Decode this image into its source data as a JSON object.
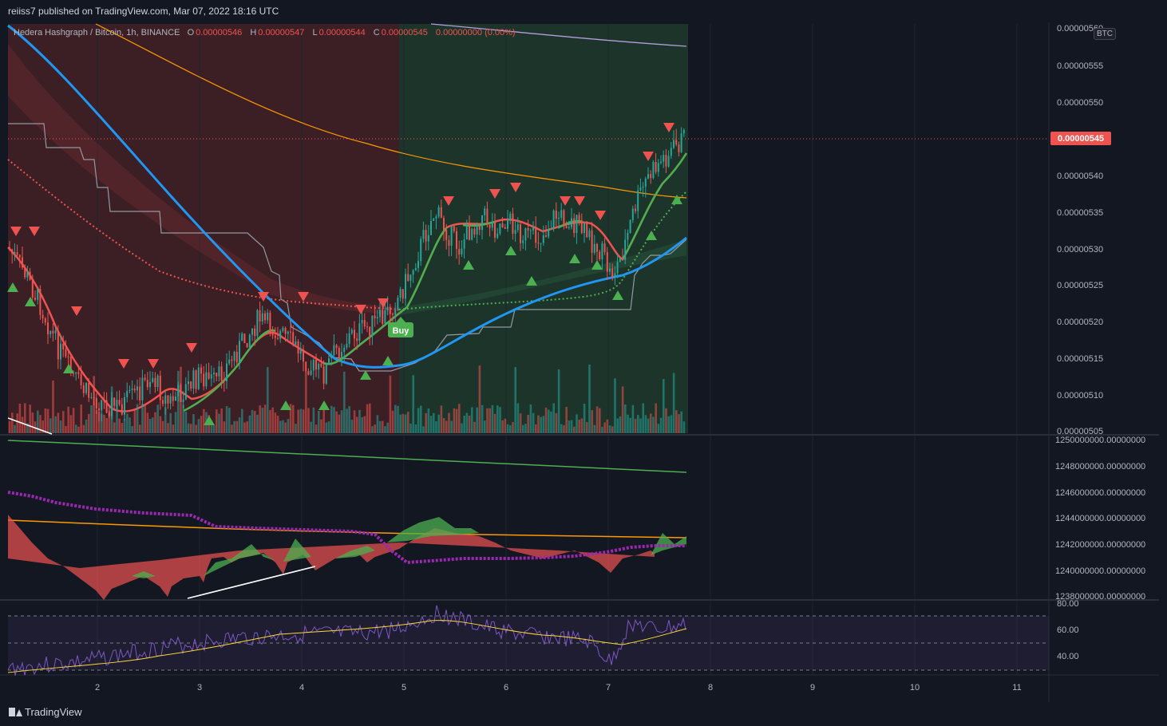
{
  "header": {
    "published": "reiiss7 published on TradingView.com, Mar 07, 2022 18:16 UTC"
  },
  "legend": {
    "symbol": "Hedera Hashgraph / Bitcoin, 1h, BINANCE",
    "o_label": "O",
    "o": "0.00000546",
    "h_label": "H",
    "h": "0.00000547",
    "l_label": "L",
    "l": "0.00000544",
    "c_label": "C",
    "c": "0.00000545",
    "change": "0.00000000 (0.00%)",
    "currency": "BTC"
  },
  "price_axis": {
    "ticks": [
      "0.00000560",
      "0.00000555",
      "0.00000550",
      "0.00000540",
      "0.00000535",
      "0.00000530",
      "0.00000525",
      "0.00000520",
      "0.00000515",
      "0.00000510",
      "0.00000505"
    ],
    "current": "0.00000545"
  },
  "osc_axis": {
    "ticks": [
      "1250000000.00000000",
      "1248000000.00000000",
      "1246000000.00000000",
      "1244000000.00000000",
      "1242000000.00000000",
      "1240000000.00000000",
      "1238000000.00000000"
    ]
  },
  "rsi_axis": {
    "ticks": [
      "80.00",
      "60.00",
      "40.00"
    ]
  },
  "time_axis": {
    "ticks": [
      "2",
      "3",
      "4",
      "5",
      "6",
      "7",
      "8",
      "9",
      "10",
      "11"
    ]
  },
  "signals": {
    "buy_label": "Buy"
  },
  "footer": {
    "brand": "TradingView"
  },
  "colors": {
    "up": "#26a69a",
    "down": "#ef5350",
    "ma_blue": "#2196f3",
    "ma_orange": "#ff9800",
    "purple": "#9c27b0",
    "green": "#4caf50",
    "red": "#ef5350",
    "bg": "#131722",
    "grid": "#2a2e39"
  },
  "chart_data": {
    "type": "line",
    "title": "Hedera Hashgraph / Bitcoin, 1h, BINANCE",
    "x": [
      "2",
      "3",
      "4",
      "5",
      "6",
      "7",
      "8"
    ],
    "series": [
      {
        "name": "Close",
        "values": [
          5.08e-06,
          5.12e-06,
          5.17e-06,
          5.22e-06,
          5.34e-06,
          5.3e-06,
          5.45e-06
        ]
      }
    ],
    "ylim": [
      5.05e-06,
      5.62e-06
    ],
    "grid": true
  }
}
